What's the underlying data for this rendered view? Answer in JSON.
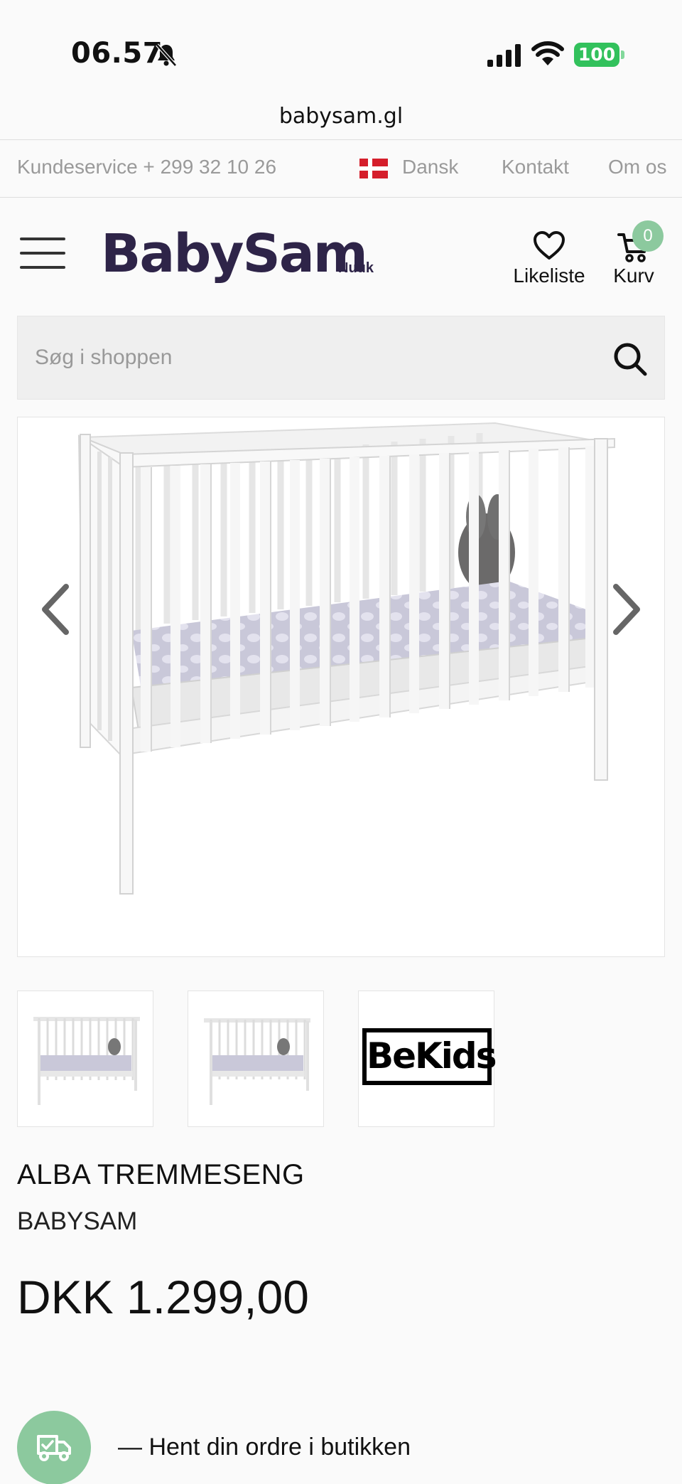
{
  "status_bar": {
    "time": "06.57",
    "battery": "100",
    "url": "babysam.gl"
  },
  "utility_bar": {
    "customer_service": "Kundeservice + 299 32 10 26",
    "language": "Dansk",
    "contact": "Kontakt",
    "about": "Om os"
  },
  "header": {
    "logo": "BabySam",
    "logo_sub": "Nuuk",
    "wishlist_label": "Likeliste",
    "cart_label": "Kurv",
    "cart_count": "0"
  },
  "search": {
    "placeholder": "Søg i shoppen"
  },
  "gallery": {
    "thumbnail_brand": "BeKids"
  },
  "product": {
    "title": "ALBA TREMMESENG",
    "brand": "BABYSAM",
    "price": "DKK 1.299,00"
  },
  "pickup": {
    "text": "— Hent din ordre i butikken"
  },
  "colors": {
    "brand": "#2e2448",
    "accent_green": "#8cc99e",
    "battery_green": "#32c15c",
    "flag_red": "#d51e2b"
  }
}
